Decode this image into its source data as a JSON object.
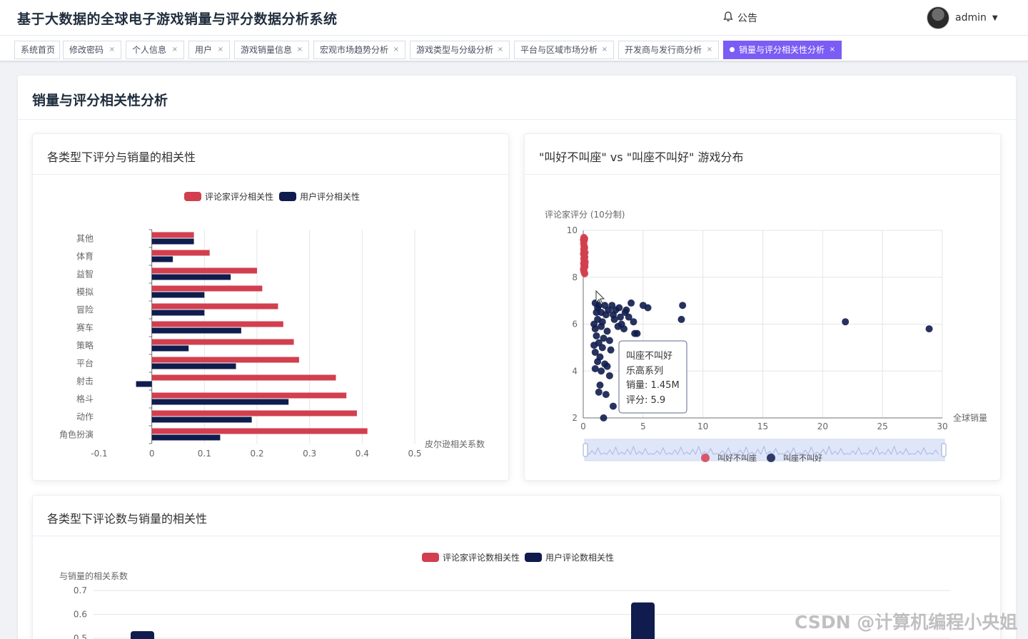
{
  "app": {
    "title": "基于大数据的全球电子游戏销量与评分数据分析系统",
    "notice_label": "公告",
    "user_name": "admin"
  },
  "tabs": [
    {
      "label": "系统首页",
      "closable": false,
      "active": false
    },
    {
      "label": "修改密码",
      "closable": true,
      "active": false
    },
    {
      "label": "个人信息",
      "closable": true,
      "active": false
    },
    {
      "label": "用户",
      "closable": true,
      "active": false
    },
    {
      "label": "游戏销量信息",
      "closable": true,
      "active": false
    },
    {
      "label": "宏观市场趋势分析",
      "closable": true,
      "active": false
    },
    {
      "label": "游戏类型与分级分析",
      "closable": true,
      "active": false
    },
    {
      "label": "平台与区域市场分析",
      "closable": true,
      "active": false
    },
    {
      "label": "开发商与发行商分析",
      "closable": true,
      "active": false
    },
    {
      "label": "销量与评分相关性分析",
      "closable": true,
      "active": true
    }
  ],
  "page": {
    "title": "销量与评分相关性分析"
  },
  "colors": {
    "critic": "#d23f4f",
    "user": "#0f1c4d",
    "accent": "#7b5cf5"
  },
  "chart_data": [
    {
      "type": "bar",
      "orientation": "horizontal",
      "title": "各类型下评分与销量的相关性",
      "categories": [
        "其他",
        "体育",
        "益智",
        "模拟",
        "冒险",
        "赛车",
        "策略",
        "平台",
        "射击",
        "格斗",
        "动作",
        "角色扮演"
      ],
      "series": [
        {
          "name": "评论家评分相关性",
          "values": [
            0.08,
            0.11,
            0.2,
            0.21,
            0.24,
            0.25,
            0.27,
            0.28,
            0.35,
            0.37,
            0.39,
            0.41
          ]
        },
        {
          "name": "用户评分相关性",
          "values": [
            0.08,
            0.04,
            0.15,
            0.1,
            0.1,
            0.17,
            0.07,
            0.16,
            -0.03,
            0.26,
            0.19,
            0.13
          ]
        }
      ],
      "xlabel": "皮尔逊相关系数",
      "xlim": [
        -0.1,
        0.5
      ],
      "xticks": [
        "-0.1",
        "0",
        "0.1",
        "0.2",
        "0.3",
        "0.4",
        "0.5"
      ],
      "legend": "top-center",
      "grid": true
    },
    {
      "type": "scatter",
      "title": "\"叫好不叫座\" vs \"叫座不叫好\" 游戏分布",
      "xlabel": "全球销量",
      "ylabel": "评论家评分 (10分制)",
      "xlim": [
        0,
        30
      ],
      "ylim": [
        2,
        10
      ],
      "xticks": [
        "0",
        "5",
        "10",
        "15",
        "20",
        "25",
        "30"
      ],
      "yticks": [
        "2",
        "4",
        "6",
        "8",
        "10"
      ],
      "grid": true,
      "legend": "bottom-center",
      "series": [
        {
          "name": "叫好不叫座",
          "points": [
            [
              0.05,
              9.7
            ],
            [
              0.08,
              9.55
            ],
            [
              0.03,
              9.45
            ],
            [
              0.1,
              9.3
            ],
            [
              0.04,
              9.2
            ],
            [
              0.07,
              9.1
            ],
            [
              0.02,
              9.0
            ],
            [
              0.09,
              8.9
            ],
            [
              0.05,
              8.8
            ],
            [
              0.11,
              8.7
            ],
            [
              0.03,
              8.6
            ],
            [
              0.06,
              8.5
            ],
            [
              0.08,
              8.4
            ],
            [
              0.04,
              8.3
            ],
            [
              0.1,
              8.2
            ],
            [
              0.12,
              9.65
            ],
            [
              0.06,
              9.35
            ],
            [
              0.09,
              8.95
            ],
            [
              0.13,
              8.55
            ],
            [
              0.05,
              8.25
            ],
            [
              0.15,
              9.05
            ],
            [
              0.07,
              8.75
            ],
            [
              0.14,
              8.45
            ],
            [
              0.02,
              8.35
            ],
            [
              0.11,
              9.25
            ],
            [
              0.16,
              8.65
            ],
            [
              0.01,
              9.6
            ],
            [
              0.12,
              8.15
            ],
            [
              0.08,
              9.15
            ],
            [
              0.13,
              8.85
            ]
          ]
        },
        {
          "name": "叫座不叫好",
          "points": [
            [
              1.0,
              6.9
            ],
            [
              1.2,
              6.7
            ],
            [
              1.5,
              6.5
            ],
            [
              1.8,
              6.8
            ],
            [
              2.1,
              6.6
            ],
            [
              2.5,
              6.4
            ],
            [
              3.0,
              6.7
            ],
            [
              3.5,
              6.5
            ],
            [
              3.8,
              6.3
            ],
            [
              4.2,
              6.1
            ],
            [
              4.5,
              5.6
            ],
            [
              4.3,
              5.6
            ],
            [
              5.0,
              6.8
            ],
            [
              5.4,
              6.7
            ],
            [
              8.3,
              6.8
            ],
            [
              8.2,
              6.2
            ],
            [
              21.9,
              6.1
            ],
            [
              28.9,
              5.8
            ],
            [
              1.1,
              5.5
            ],
            [
              1.3,
              5.2
            ],
            [
              1.6,
              5.0
            ],
            [
              1.0,
              4.8
            ],
            [
              1.4,
              4.6
            ],
            [
              1.2,
              4.4
            ],
            [
              1.8,
              4.3
            ],
            [
              1.5,
              4.0
            ],
            [
              2.0,
              4.2
            ],
            [
              2.2,
              3.8
            ],
            [
              1.4,
              3.4
            ],
            [
              1.3,
              3.1
            ],
            [
              1.9,
              3.0
            ],
            [
              2.5,
              2.5
            ],
            [
              1.7,
              2.0
            ],
            [
              0.9,
              6.0
            ],
            [
              1.0,
              5.8
            ],
            [
              2.6,
              6.2
            ],
            [
              3.2,
              6.0
            ],
            [
              2.0,
              5.7
            ],
            [
              1.6,
              6.1
            ],
            [
              1.1,
              6.5
            ],
            [
              2.9,
              5.9
            ],
            [
              3.6,
              6.6
            ],
            [
              1.2,
              6.2
            ],
            [
              1.7,
              5.4
            ],
            [
              2.4,
              6.8
            ],
            [
              3.1,
              6.3
            ],
            [
              1.0,
              4.1
            ],
            [
              2.3,
              4.9
            ],
            [
              1.5,
              5.9
            ],
            [
              2.7,
              6.6
            ],
            [
              0.9,
              5.1
            ],
            [
              1.9,
              6.4
            ],
            [
              4.0,
              6.9
            ],
            [
              3.4,
              5.8
            ],
            [
              1.3,
              6.8
            ],
            [
              2.2,
              5.3
            ]
          ]
        }
      ],
      "tooltip": {
        "category": "叫座不叫好",
        "name": "乐高系列",
        "sales_label": "销量",
        "sales_value": "1.45M",
        "score_label": "评分",
        "score_value": "5.9"
      }
    },
    {
      "type": "bar",
      "title": "各类型下评论数与销量的相关性",
      "ylabel": "与销量的相关系数",
      "ylim": [
        0.5,
        0.7
      ],
      "yticks": [
        "0.5",
        "0.6",
        "0.7"
      ],
      "legend": "top-center",
      "grid": true,
      "series": [
        {
          "name": "评论家评论数相关性",
          "values": []
        },
        {
          "name": "用户评论数相关性",
          "values": [
            0.53,
            0.65
          ]
        }
      ]
    }
  ],
  "watermark": "CSDN @计算机编程小央姐"
}
